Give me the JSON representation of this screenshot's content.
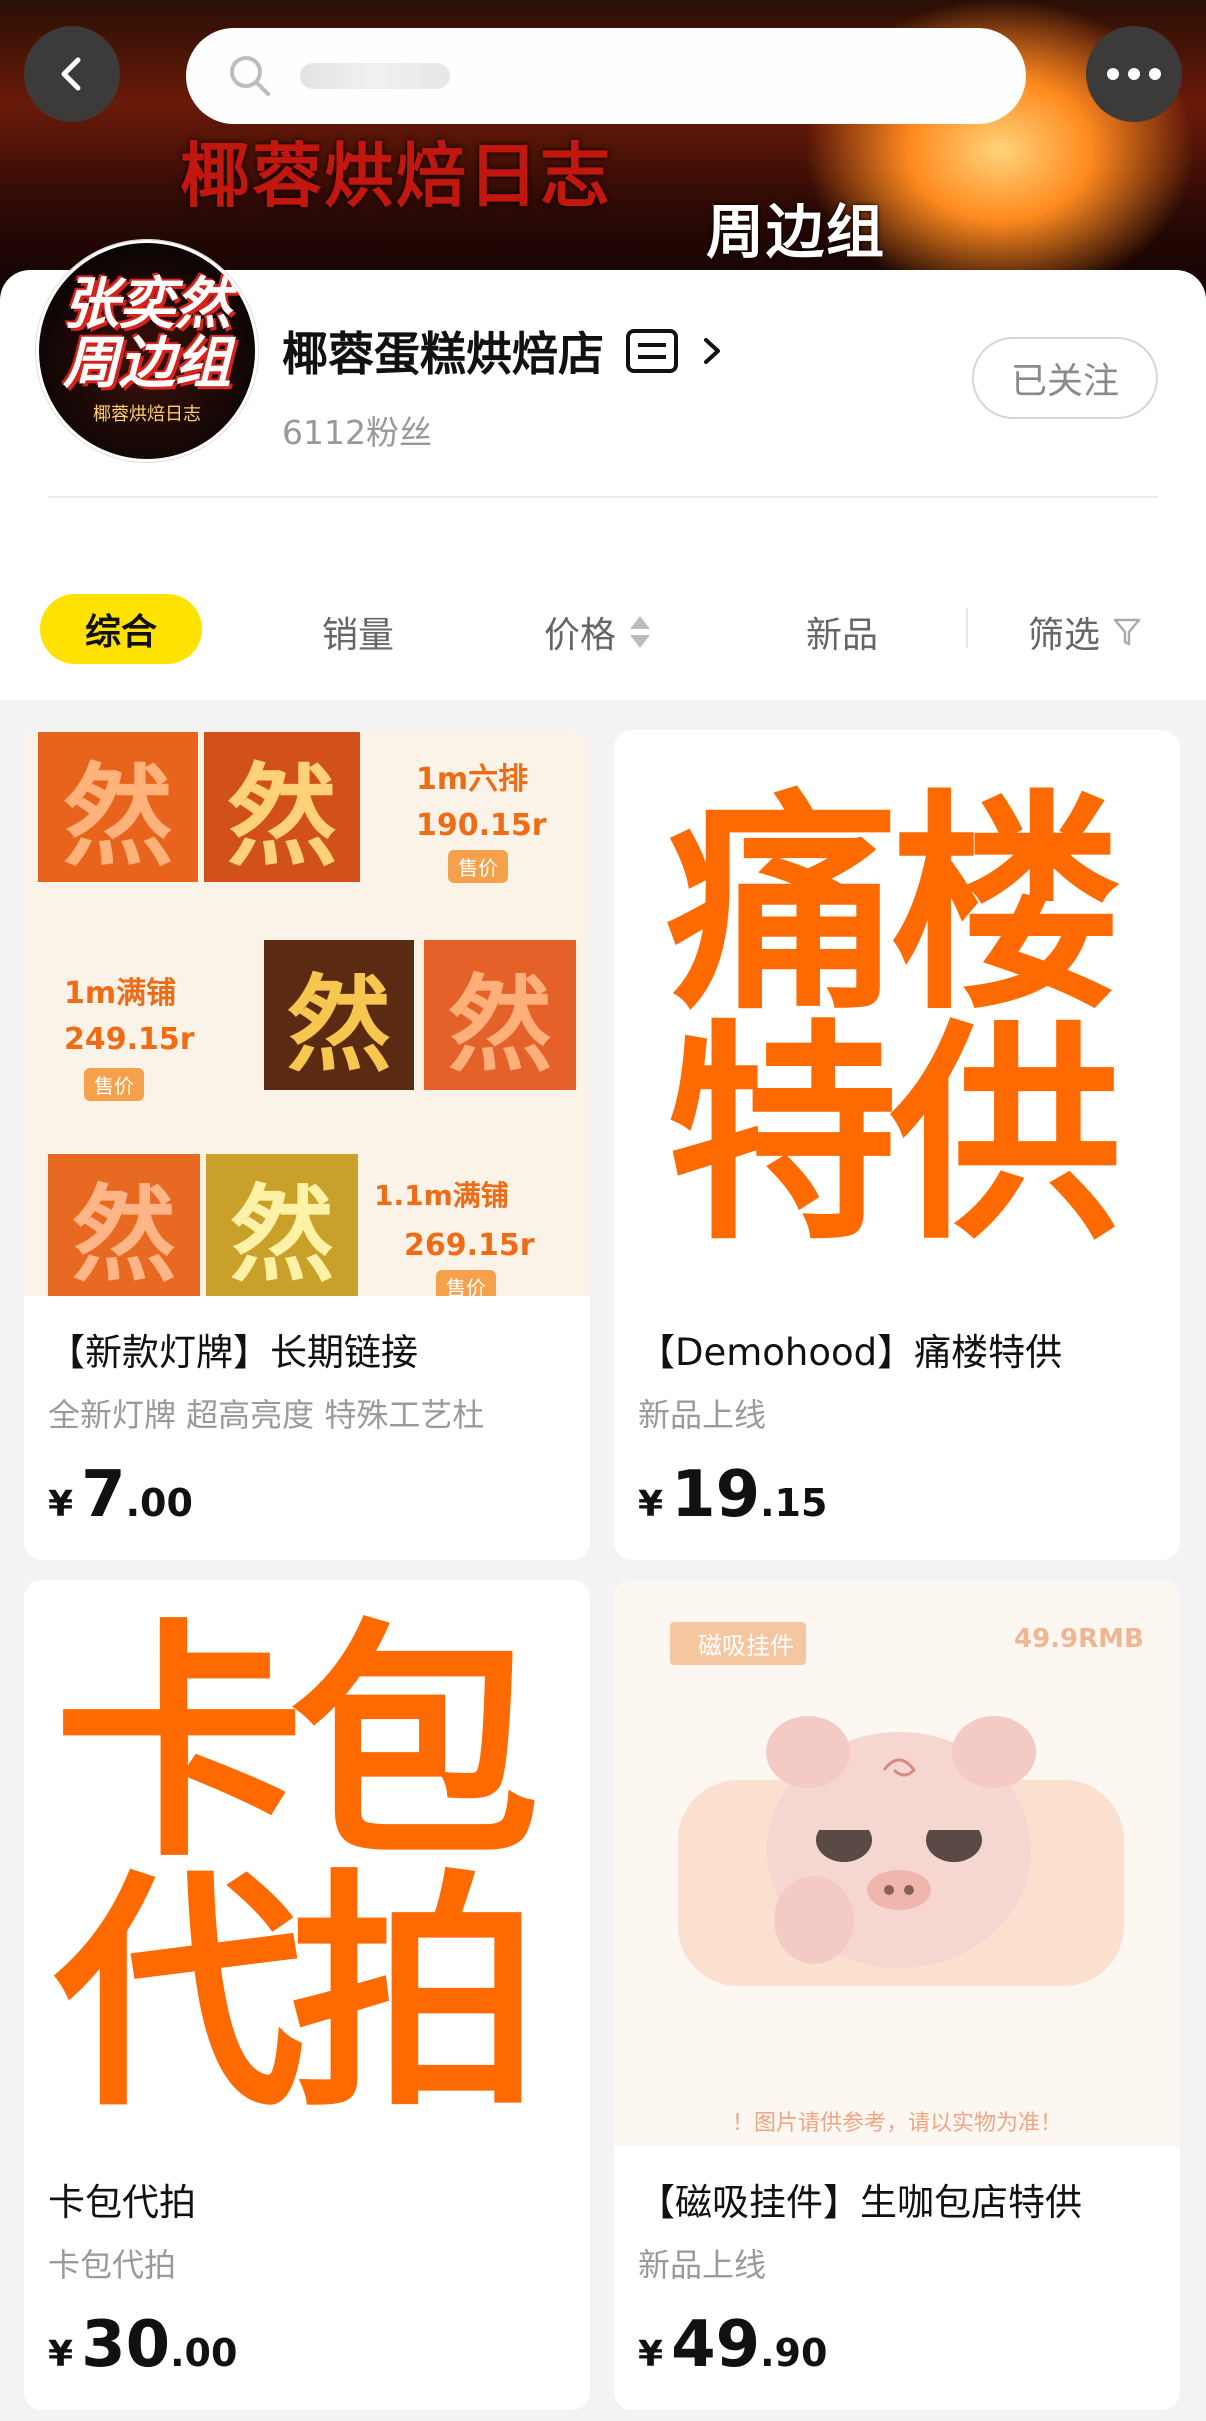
{
  "banner": {
    "title": "椰蓉烘焙日志",
    "subtitle": "周边组"
  },
  "nav": {
    "back_icon": "chevron-left-icon",
    "search_icon": "search-icon",
    "more_icon": "more-dots-icon"
  },
  "shop": {
    "avatar_line1": "张奕然",
    "avatar_line2": "周边组",
    "avatar_line3": "椰蓉烘焙日志",
    "name": "椰蓉蛋糕烘焙店",
    "fans": "6112粉丝",
    "follow_label": "已关注"
  },
  "sort": {
    "items": [
      "综合",
      "销量",
      "价格",
      "新品",
      "筛选"
    ],
    "active": "综合"
  },
  "products": [
    {
      "title": "【新款灯牌】长期链接",
      "subtitle": "全新灯牌 超高亮度 特殊工艺杜",
      "price_int": "7",
      "price_dec": ".00",
      "thumb": {
        "label_a": "1m六排",
        "price_a": "190.15r",
        "label_b": "1m满铺",
        "price_b": "249.15r",
        "label_c": "1.1m满铺",
        "price_c": "269.15r",
        "tag": "售价",
        "glyph": "然"
      }
    },
    {
      "title": "【Demohood】痛楼特供",
      "subtitle": "新品上线",
      "price_int": "19",
      "price_dec": ".15",
      "thumb": {
        "line1": "痛楼",
        "line2": "特供"
      }
    },
    {
      "title": "卡包代拍",
      "subtitle": "卡包代拍",
      "price_int": "30",
      "price_dec": ".00",
      "thumb": {
        "line1": "卡包",
        "line2": "代拍"
      }
    },
    {
      "title": "【磁吸挂件】生咖包店特供",
      "subtitle": "新品上线",
      "price_int": "49",
      "price_dec": ".90",
      "thumb": {
        "tag": "磁吸挂件",
        "price": "49.9RMB",
        "note": "！图片请供参考，请以实物为准！"
      }
    }
  ],
  "currency": "¥",
  "colors": {
    "accent": "#ffe200",
    "brand_orange": "#ff6a00"
  }
}
